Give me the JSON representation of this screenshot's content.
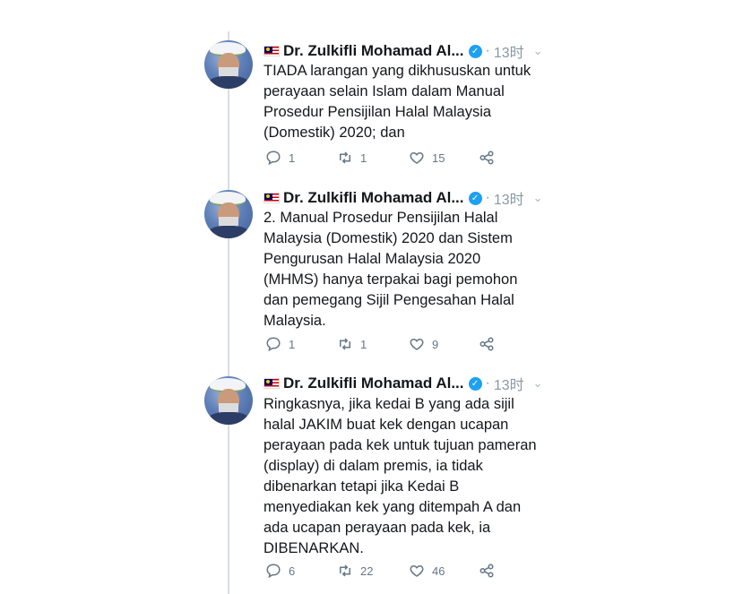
{
  "tweets": [
    {
      "author": "Dr. Zulkifli Mohamad Al...",
      "verified_glyph": "✓",
      "separator": "·",
      "time": "13时",
      "more_glyph": "⌄",
      "lines": [
        "TIADA larangan yang dikhususkan untuk",
        "perayaan selain Islam dalam Manual",
        "Prosedur Pensijilan Halal Malaysia",
        "(Domestik) 2020; dan"
      ],
      "replies": "1",
      "retweets": "1",
      "likes": "15"
    },
    {
      "author": "Dr. Zulkifli Mohamad Al...",
      "verified_glyph": "✓",
      "separator": "·",
      "time": "13时",
      "more_glyph": "⌄",
      "lines": [
        "2. Manual Prosedur Pensijilan Halal",
        "Malaysia (Domestik) 2020 dan Sistem",
        "Pengurusan Halal Malaysia 2020",
        "(MHMS) hanya terpakai bagi pemohon",
        "dan pemegang Sijil Pengesahan Halal",
        "Malaysia."
      ],
      "replies": "1",
      "retweets": "1",
      "likes": "9"
    },
    {
      "author": "Dr. Zulkifli Mohamad Al...",
      "verified_glyph": "✓",
      "separator": "·",
      "time": "13时",
      "more_glyph": "⌄",
      "lines": [
        "Ringkasnya, jika kedai B yang ada sijil",
        "halal JAKIM buat kek dengan ucapan",
        "perayaan pada kek untuk tujuan pameran",
        "(display) di dalam premis, ia tidak",
        "dibenarkan tetapi jika Kedai B",
        "menyediakan kek yang ditempah A dan",
        "ada ucapan perayaan pada kek, ia",
        "DIBENARKAN."
      ],
      "replies": "6",
      "retweets": "22",
      "likes": "46"
    }
  ],
  "icons": {
    "flag": "malaysia-flag-icon",
    "verified": "verified-badge-icon",
    "reply": "reply-icon",
    "retweet": "retweet-icon",
    "like": "heart-icon",
    "share": "share-icon"
  },
  "colors": {
    "verified": "#1da1f2",
    "muted": "#657786",
    "thread_line": "#d8dde2"
  }
}
